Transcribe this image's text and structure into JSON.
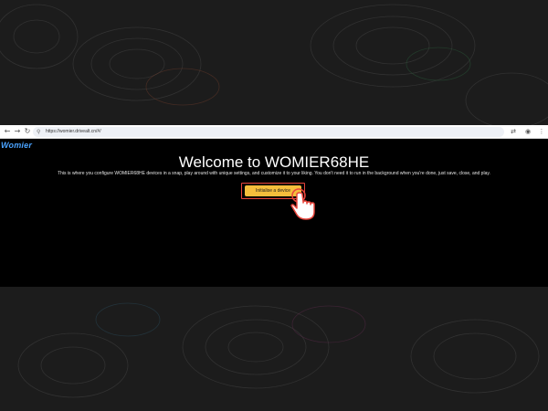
{
  "browser": {
    "back_icon": "arrow-left-icon",
    "forward_icon": "arrow-right-icon",
    "reload_icon": "reload-icon",
    "url": "https://womier.drivealt.cn/#/",
    "translate_icon": "translate-icon",
    "profile_icon": "profile-icon",
    "menu_icon": "kebab-menu-icon"
  },
  "app": {
    "logo": "Womier",
    "title": "Welcome to WOMIER68HE",
    "subtitle": "This is where you configure WOMIER68HE devices in a snap, play around with unique settings, and customize it to your liking. You don't need it to run in the background when you're done, just save, close, and play.",
    "cta_label": "Initialise a device"
  },
  "colors": {
    "background": "#1c1c1c",
    "viewport": "#000000",
    "logo": "#4aa3ff",
    "cta": "#f5be3c",
    "highlight": "#e8453c"
  }
}
